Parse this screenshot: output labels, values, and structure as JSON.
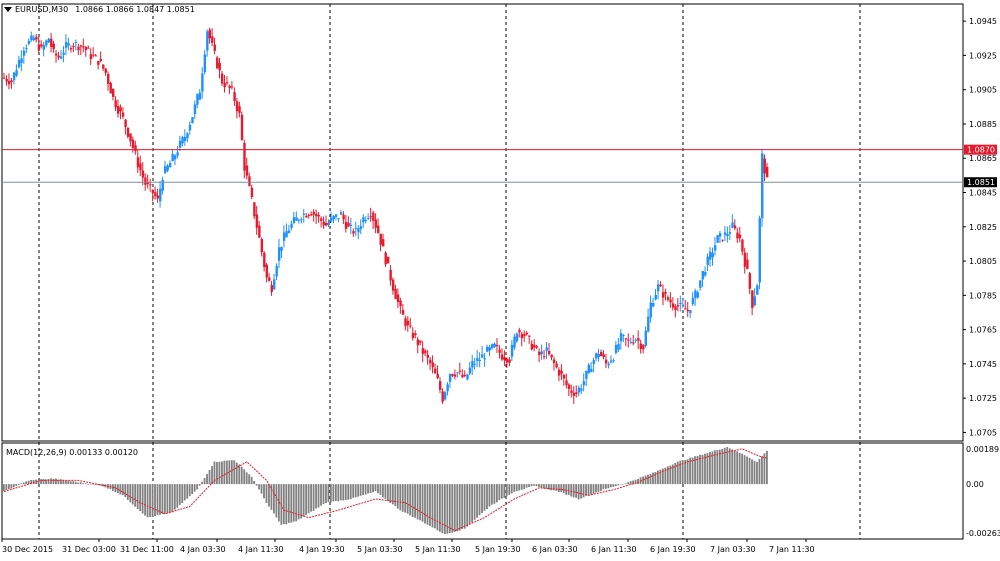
{
  "header": {
    "symbol_label": "EURUSD,M30",
    "ohlc_label": "1.0866 1.0866 1.0847 1.0851"
  },
  "macd_header": {
    "label": "MACD(12,26,9) 0.00133 0.00120"
  },
  "colors": {
    "bull": "#1e90ff",
    "bear": "#e8192c",
    "hist": "#808080",
    "signal": "#e8192c",
    "hline_red": "#e8192c",
    "hline_gray": "#7a8fa6",
    "grid": "#000000"
  },
  "chart_data": [
    {
      "type": "candlestick",
      "title": "EURUSD,M30",
      "ylim": [
        1.07,
        1.0955
      ],
      "y_ticks": [
        "1.0945",
        "1.0925",
        "1.0905",
        "1.0885",
        "1.0865",
        "1.0845",
        "1.0825",
        "1.0805",
        "1.0785",
        "1.0765",
        "1.0745",
        "1.0725",
        "1.0705"
      ],
      "x_ticks": [
        "30 Dec 2015",
        "31 Dec 03:00",
        "31 Dec 11:00",
        "4 Jan 03:30",
        "4 Jan 11:30",
        "4 Jan 19:30",
        "5 Jan 03:30",
        "5 Jan 11:30",
        "5 Jan 19:30",
        "6 Jan 03:30",
        "6 Jan 11:30",
        "6 Jan 19:30",
        "7 Jan 03:30",
        "7 Jan 11:30"
      ],
      "horizontal_lines": [
        {
          "value": 1.087,
          "label": "1.0870",
          "style": "red"
        },
        {
          "value": 1.0851,
          "label": "1.0851",
          "style": "current"
        }
      ],
      "grid": "vertical dashed",
      "anchors": [
        [
          0,
          1.0912
        ],
        [
          3,
          1.091
        ],
        [
          5,
          1.0918
        ],
        [
          8,
          1.093
        ],
        [
          12,
          1.0935
        ],
        [
          15,
          1.0928
        ],
        [
          18,
          1.0935
        ],
        [
          20,
          1.0926
        ],
        [
          22,
          1.0924
        ],
        [
          25,
          1.093
        ],
        [
          28,
          1.0932
        ],
        [
          32,
          1.093
        ],
        [
          35,
          1.0925
        ],
        [
          38,
          1.0922
        ],
        [
          41,
          1.0915
        ],
        [
          44,
          1.09
        ],
        [
          48,
          1.0888
        ],
        [
          51,
          1.0876
        ],
        [
          54,
          1.0862
        ],
        [
          57,
          1.085
        ],
        [
          60,
          1.0845
        ],
        [
          62,
          1.084
        ],
        [
          64,
          1.0855
        ],
        [
          67,
          1.0862
        ],
        [
          70,
          1.087
        ],
        [
          73,
          1.0878
        ],
        [
          76,
          1.089
        ],
        [
          79,
          1.0905
        ],
        [
          82,
          1.094
        ],
        [
          85,
          1.0925
        ],
        [
          88,
          1.091
        ],
        [
          92,
          1.0904
        ],
        [
          95,
          1.089
        ],
        [
          97,
          1.086
        ],
        [
          100,
          1.084
        ],
        [
          103,
          1.0818
        ],
        [
          106,
          1.0795
        ],
        [
          108,
          1.079
        ],
        [
          111,
          1.0812
        ],
        [
          114,
          1.0822
        ],
        [
          117,
          1.0828
        ],
        [
          120,
          1.0832
        ],
        [
          124,
          1.0834
        ],
        [
          127,
          1.083
        ],
        [
          130,
          1.0826
        ],
        [
          133,
          1.083
        ],
        [
          136,
          1.0832
        ],
        [
          139,
          1.0824
        ],
        [
          142,
          1.0822
        ],
        [
          145,
          1.083
        ],
        [
          148,
          1.0834
        ],
        [
          151,
          1.0822
        ],
        [
          154,
          1.0806
        ],
        [
          157,
          1.079
        ],
        [
          160,
          1.0776
        ],
        [
          163,
          1.0766
        ],
        [
          166,
          1.076
        ],
        [
          169,
          1.0752
        ],
        [
          172,
          1.0745
        ],
        [
          175,
          1.0735
        ],
        [
          177,
          1.0725
        ],
        [
          180,
          1.074
        ],
        [
          183,
          1.074
        ],
        [
          186,
          1.0736
        ],
        [
          189,
          1.0745
        ],
        [
          192,
          1.0748
        ],
        [
          195,
          1.0752
        ],
        [
          198,
          1.0755
        ],
        [
          201,
          1.075
        ],
        [
          204,
          1.0748
        ],
        [
          207,
          1.0765
        ],
        [
          210,
          1.0762
        ],
        [
          213,
          1.0756
        ],
        [
          216,
          1.075
        ],
        [
          219,
          1.0752
        ],
        [
          222,
          1.0745
        ],
        [
          225,
          1.0738
        ],
        [
          228,
          1.073
        ],
        [
          231,
          1.0728
        ],
        [
          234,
          1.0735
        ],
        [
          237,
          1.0745
        ],
        [
          240,
          1.0752
        ],
        [
          243,
          1.0745
        ],
        [
          246,
          1.075
        ],
        [
          249,
          1.076
        ],
        [
          252,
          1.0758
        ],
        [
          255,
          1.076
        ],
        [
          258,
          1.0755
        ],
        [
          261,
          1.078
        ],
        [
          264,
          1.079
        ],
        [
          267,
          1.0784
        ],
        [
          270,
          1.078
        ],
        [
          273,
          1.0778
        ],
        [
          276,
          1.0776
        ],
        [
          279,
          1.0785
        ],
        [
          282,
          1.0798
        ],
        [
          285,
          1.0808
        ],
        [
          288,
          1.0818
        ],
        [
          291,
          1.082
        ],
        [
          294,
          1.0825
        ],
        [
          297,
          1.0818
        ],
        [
          300,
          1.0798
        ],
        [
          302,
          1.078
        ],
        [
          304,
          1.0792
        ],
        [
          306,
          1.0866
        ],
        [
          308,
          1.0851
        ]
      ]
    },
    {
      "type": "histogram+line",
      "title": "MACD(12,26,9) 0.00133 0.00120",
      "ylim": [
        -0.00263,
        0.00189
      ],
      "y_ticks": [
        "0.00189",
        "0.00",
        "-0.00263"
      ],
      "anchors_hist": [
        [
          0,
          -0.0004
        ],
        [
          10,
          0.0002
        ],
        [
          20,
          0.0003
        ],
        [
          40,
          -0.0001
        ],
        [
          48,
          -0.0006
        ],
        [
          58,
          -0.0018
        ],
        [
          68,
          -0.0015
        ],
        [
          78,
          -0.0003
        ],
        [
          85,
          0.0012
        ],
        [
          93,
          0.0013
        ],
        [
          100,
          0.0004
        ],
        [
          106,
          -0.001
        ],
        [
          112,
          -0.0022
        ],
        [
          118,
          -0.002
        ],
        [
          130,
          -0.001
        ],
        [
          140,
          -0.0008
        ],
        [
          150,
          -0.0004
        ],
        [
          160,
          -0.0014
        ],
        [
          170,
          -0.0021
        ],
        [
          178,
          -0.0027
        ],
        [
          186,
          -0.0024
        ],
        [
          196,
          -0.0012
        ],
        [
          206,
          -0.0004
        ],
        [
          214,
          -0.0001
        ],
        [
          224,
          -0.0004
        ],
        [
          232,
          -0.0008
        ],
        [
          242,
          -0.0003
        ],
        [
          252,
          0.0001
        ],
        [
          262,
          0.0006
        ],
        [
          272,
          0.0012
        ],
        [
          282,
          0.0016
        ],
        [
          292,
          0.002
        ],
        [
          300,
          0.0015
        ],
        [
          304,
          0.0012
        ],
        [
          308,
          0.0018
        ]
      ],
      "anchors_signal": [
        [
          0,
          -0.0004
        ],
        [
          15,
          0.0002
        ],
        [
          30,
          0.0002
        ],
        [
          45,
          -0.0002
        ],
        [
          55,
          -0.001
        ],
        [
          65,
          -0.0016
        ],
        [
          75,
          -0.0012
        ],
        [
          85,
          0.0002
        ],
        [
          98,
          0.0012
        ],
        [
          106,
          0.0002
        ],
        [
          113,
          -0.0014
        ],
        [
          123,
          -0.0018
        ],
        [
          135,
          -0.0014
        ],
        [
          150,
          -0.0008
        ],
        [
          162,
          -0.001
        ],
        [
          172,
          -0.0018
        ],
        [
          182,
          -0.0025
        ],
        [
          194,
          -0.0018
        ],
        [
          206,
          -0.0008
        ],
        [
          216,
          -0.0002
        ],
        [
          226,
          -0.0003
        ],
        [
          236,
          -0.0006
        ],
        [
          246,
          -0.0003
        ],
        [
          256,
          0.0001
        ],
        [
          266,
          0.0007
        ],
        [
          276,
          0.0012
        ],
        [
          288,
          0.0016
        ],
        [
          298,
          0.0019
        ],
        [
          305,
          0.0015
        ],
        [
          308,
          0.0014
        ]
      ]
    }
  ]
}
